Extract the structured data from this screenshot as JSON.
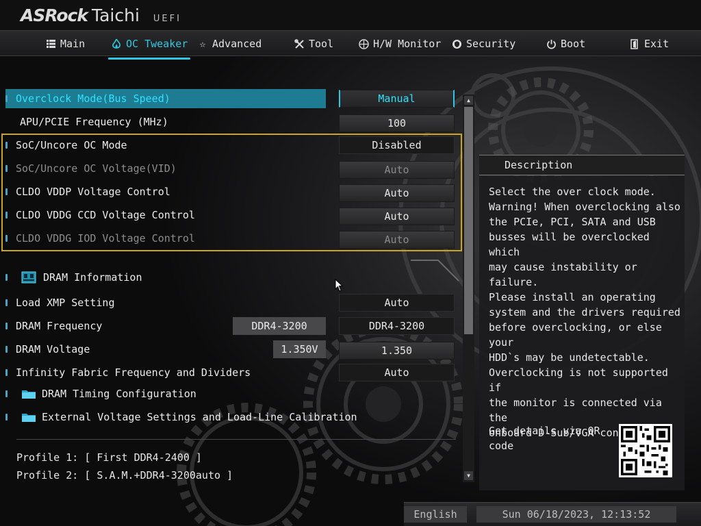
{
  "brand": {
    "name_a": "ASRock",
    "name_b": "Taichi",
    "name_c": "UEFI"
  },
  "nav": {
    "tabs": [
      {
        "label": "Main",
        "icon": "list-icon"
      },
      {
        "label": "OC Tweaker",
        "icon": "flame-icon",
        "active": true
      },
      {
        "label": "Advanced",
        "icon": "star-icon"
      },
      {
        "label": "Tool",
        "icon": "tools-icon"
      },
      {
        "label": "H/W Monitor",
        "icon": "monitor-icon"
      },
      {
        "label": "Security",
        "icon": "shield-icon"
      },
      {
        "label": "Boot",
        "icon": "power-icon"
      },
      {
        "label": "Exit",
        "icon": "exit-icon"
      }
    ]
  },
  "settings": [
    {
      "label": "Overclock Mode(Bus Speed)",
      "value": "Manual",
      "state": "selected"
    },
    {
      "label": "APU/PCIE Frequency (MHz)",
      "value": "100",
      "state": "normal"
    },
    {
      "label": "SoC/Uncore OC Mode",
      "value": "Disabled",
      "state": "normal"
    },
    {
      "label": "SoC/Uncore OC Voltage(VID)",
      "value": "Auto",
      "state": "disabled"
    },
    {
      "label": "CLDO VDDP Voltage Control",
      "value": "Auto",
      "state": "normal"
    },
    {
      "label": "CLDO VDDG CCD Voltage Control",
      "value": "Auto",
      "state": "normal"
    },
    {
      "label": "CLDO VDDG IOD Voltage Control",
      "value": "Auto",
      "state": "disabled"
    }
  ],
  "dram": {
    "info_label": "DRAM Information",
    "xmp_label": "Load XMP Setting",
    "xmp_value": "Auto",
    "freq_label": "DRAM Frequency",
    "freq_current": "DDR4-3200",
    "freq_value": "DDR4-3200",
    "volt_label": "DRAM Voltage",
    "volt_current": "1.350V",
    "volt_value": "1.350",
    "fabric_label": "Infinity Fabric Frequency and Dividers",
    "fabric_value": "Auto",
    "timing_label": "DRAM Timing Configuration",
    "external_label": "External Voltage Settings and Load-Line Calibration"
  },
  "profiles": {
    "p1": "Profile 1: [ First DDR4-2400 ]",
    "p2": "Profile 2: [ S.A.M.+DDR4-3200auto ]"
  },
  "description": {
    "title": "Description",
    "text": "Select the over clock mode.\nWarning! When overclocking also\nthe PCIe, PCI, SATA and USB\nbusses will be overclocked which\nmay cause instability or failure.\nPlease install an operating\nsystem and the drivers required\nbefore overclocking, or else your\nHDD`s may be undetectable.\nOverclocking is not supported if\nthe monitor is connected via the\nonboard D-Sub/VGA connector.",
    "qr_text": "Get details via QR code"
  },
  "footer": {
    "language": "English",
    "datetime": "Sun 06/18/2023, 12:13:52"
  },
  "colors": {
    "accent": "#2ec9e6",
    "highlight_box": "#c9a520",
    "selected_row": "#1e7c92"
  }
}
